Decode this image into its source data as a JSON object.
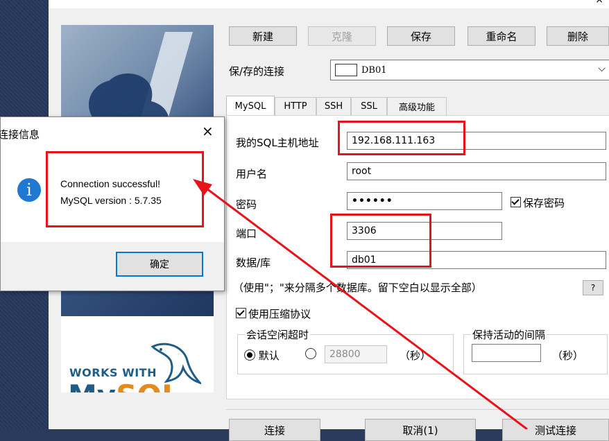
{
  "toolbar": {
    "new_label": "新建",
    "clone_label": "克隆",
    "save_label": "保存",
    "rename_label": "重命名",
    "delete_label": "删除"
  },
  "saved_connections": {
    "label": "保/存的连接",
    "selected": "DB01"
  },
  "tabs": [
    {
      "label": "MySQL"
    },
    {
      "label": "HTTP"
    },
    {
      "label": "SSH"
    },
    {
      "label": "SSL"
    },
    {
      "label": "高级功能"
    }
  ],
  "form": {
    "host_label": "我的SQL主机地址",
    "host_value": "192.168.111.163",
    "user_label": "用户名",
    "user_value": "root",
    "password_label": "密码",
    "password_value": "••••••",
    "save_password_label": "保存密码",
    "port_label": "端口",
    "port_value": "3306",
    "database_label": "数据/库",
    "database_value": "db01",
    "database_hint": "（使用\"；\"来分隔多个数据库。留下空白以显示全部）",
    "help_label": "?",
    "compression_label": "使用压缩协议",
    "session_timeout": {
      "title": "会话空闲超时",
      "default_label": "默认",
      "value": "28800",
      "unit": "（秒）"
    },
    "keepalive": {
      "title": "保持活动的间隔",
      "value": "",
      "unit": "（秒）"
    }
  },
  "bottom_buttons": {
    "connect_label": "连接",
    "cancel_label": "取消(1)",
    "test_label": "测试连接"
  },
  "banner": {
    "works_with": "WORKS WITH",
    "mysql_my": "My",
    "mysql_sql": "SQL"
  },
  "message_dialog": {
    "title": "连接信息",
    "close": "×",
    "icon_char": "i",
    "line1": "Connection successful!",
    "line2": "MySQL version : 5.7.35",
    "ok_label": "确定"
  },
  "colors": {
    "highlight": "#e8131a",
    "arrow": "#e8131a",
    "info_icon": "#1f78d1"
  }
}
